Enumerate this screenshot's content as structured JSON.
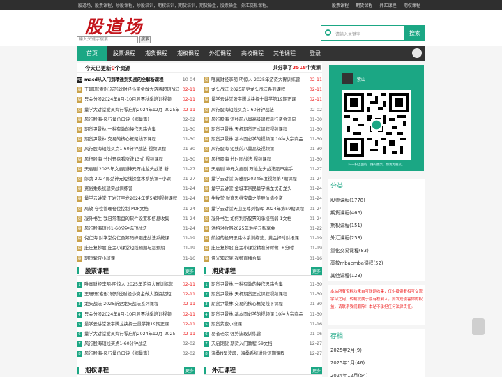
{
  "topbar": {
    "text": "股道场，股票课程，炒股课程，炒股培训，期权培训，期货培训，期货操盘，股票操盘，外汇交易课程。",
    "links": [
      "股票课程",
      "期货课程",
      "外汇课程",
      "期权课程"
    ]
  },
  "logo": "股道场",
  "mini_search": {
    "placeholder": "输入关键字搜索",
    "button": "搜索"
  },
  "search": {
    "placeholder": "请输入关键字",
    "button": "搜索"
  },
  "nav": [
    "首页",
    "股票课程",
    "期货课程",
    "期权课程",
    "外汇课程",
    "高校课程",
    "其他课程",
    "登录"
  ],
  "today": {
    "prefix": "今天已更新",
    "count": "0",
    "suffix": "个资源",
    "total_prefix": "共分享了",
    "total": "3518",
    "total_suffix": "个资源"
  },
  "latest_left": [
    {
      "t": "macd从入门到精通到实战的全解析课程",
      "d": "10-04",
      "hot": false,
      "first": true
    },
    {
      "t": "王珊珊(索彤)炭形说财经小资金做大游资超短战法",
      "d": "02-11",
      "hot": true
    },
    {
      "t": "只会分股2024年8月-10月股票秋季培训视频",
      "d": "02-11",
      "hot": true
    },
    {
      "t": "量学大讲堂爱灵海行零启航2024年12月-2025年1月",
      "d": "02-11",
      "hot": true
    },
    {
      "t": "风行股海-风行量价口诀（缩量篇）",
      "d": "02-02",
      "hot": false
    },
    {
      "t": "期货尹景林 一种有效的操作思路合集",
      "d": "01-30",
      "hot": false
    },
    {
      "t": "期货尹景林 交易的核心框架线下课程",
      "d": "01-30",
      "hot": false
    },
    {
      "t": "风行股海短线买点1-60分钟战法 视频课程",
      "d": "01-30",
      "hot": false
    },
    {
      "t": "风行股海 分时开盘看涨跌13式 视频课程",
      "d": "01-30",
      "hot": false
    },
    {
      "t": "天启剧 2025年文启剧神元万维龙头战法 新",
      "d": "01-27",
      "hot": false
    },
    {
      "t": "郎劲 2024郎劲神元短线操盘术系统课+小课",
      "d": "01-27",
      "hot": false
    },
    {
      "t": "资俗乘系统建实战训练营",
      "d": "01-24",
      "hot": false
    },
    {
      "t": "量学云讲堂 王岩江宇龙2024年第54期视频课程",
      "d": "01-24",
      "hot": false
    },
    {
      "t": "局放 仓位管理仓位控制 PDF文档",
      "d": "01-24",
      "hot": false
    },
    {
      "t": "凝外书生 我日常看盘的软件设置和信息收集",
      "d": "01-24",
      "hot": false
    },
    {
      "t": "风行股海短线1-60分钟选顶战法",
      "d": "01-24",
      "hot": false
    },
    {
      "t": "倪仁海 财学堂倪仁勇筹码峰跟庄战法系统课",
      "d": "01-19",
      "hot": false
    },
    {
      "t": "庄庄复抄股 庄主小课堂短线预期与超预期",
      "d": "01-19",
      "hot": false
    },
    {
      "t": "期货紫夜小班课",
      "d": "01-16",
      "hot": false
    }
  ],
  "latest_right": [
    {
      "t": "唯真财经李明-明惊人 2025年游资大胃训练营",
      "d": "02-11",
      "hot": true
    },
    {
      "t": "龙头战法 2025新更龙头战法系列课程",
      "d": "02-11",
      "hot": true
    },
    {
      "t": "量学云讲堂张宇腾龙抉择士量学第19期正课",
      "d": "02-11",
      "hot": true
    },
    {
      "t": "风行股海短线买点1-60分钟战法",
      "d": "02-02",
      "hot": false
    },
    {
      "t": "风行股海 短线前八量高级课程风行资金流向",
      "d": "01-30",
      "hot": false
    },
    {
      "t": "期货尹景林 天机期货正式课程视频课程",
      "d": "01-30",
      "hot": false
    },
    {
      "t": "期货尹景林 基本面必学的视频课 10种大宗商品",
      "d": "01-30",
      "hot": false
    },
    {
      "t": "风行股海 短线前八量高级视频课",
      "d": "01-30",
      "hot": false
    },
    {
      "t": "风行股海 分时图战法 视频课程",
      "d": "01-30",
      "hot": false
    },
    {
      "t": "天启剧 神元文启剧 万维龙头战法股市高手",
      "d": "01-27",
      "hot": false
    },
    {
      "t": "量学云讲堂 冯雅丽2024年度视频第7期课程",
      "d": "01-24",
      "hot": false
    },
    {
      "t": "量学云讲堂 金城李宗民量学擒龙伏击龙头",
      "d": "01-24",
      "hot": false
    },
    {
      "t": "牛牧堂 财商思维宝典之美股价值投资",
      "d": "01-24",
      "hot": false
    },
    {
      "t": "量学云讲堂天山至尊刘智晖 2024年第59期课程",
      "d": "01-24",
      "hot": false
    },
    {
      "t": "凝外书生 如何判断股票的承接强弱 1文档",
      "d": "01-24",
      "hot": false
    },
    {
      "t": "洪榕洪攻略2025年洪榕云私享会",
      "d": "01-22",
      "hot": false
    },
    {
      "t": "航姐的投研思路体系训练营，黄金择时财报课",
      "d": "01-19",
      "hot": false
    },
    {
      "t": "庄庄复抄股 庄主小课堂精准分时做T+分时",
      "d": "01-19",
      "hot": false
    },
    {
      "t": "佛光知识底 视频直播合集",
      "d": "01-16",
      "hot": false
    }
  ],
  "stock": {
    "title": "股票课程",
    "more": "更多",
    "items": [
      {
        "t": "唯真财经李明-明惊人 2025年游资大胃训练营",
        "d": "02-11",
        "hot": true
      },
      {
        "t": "王珊珊(索彤)炭形说财经小资金做大游资超短",
        "d": "02-11",
        "hot": true
      },
      {
        "t": "龙头战法 2025新更龙头战法系列课程",
        "d": "02-11",
        "hot": true
      },
      {
        "t": "只会分股2024年8月-10月股票秋季培训视频",
        "d": "02-11",
        "hot": true
      },
      {
        "t": "量学云讲堂张宇腾龙抉择士量学第19期正课",
        "d": "02-11",
        "hot": true
      },
      {
        "t": "量学大讲堂爱灵海行零启航2024年12月-2025",
        "d": "02-11",
        "hot": true
      },
      {
        "t": "风行股海短线买点1-60分钟战法",
        "d": "02-02",
        "hot": false
      },
      {
        "t": "风行股海-风行量价口诀（缩量篇）",
        "d": "02-02",
        "hot": false
      }
    ]
  },
  "futures": {
    "title": "期货课程",
    "more": "更多",
    "items": [
      {
        "t": "期货尹景林 一种有效的操作思路合集",
        "d": "01-30",
        "hot": false
      },
      {
        "t": "期货尹景林 天机期货正式课程视频课程",
        "d": "01-30",
        "hot": false
      },
      {
        "t": "期货尹景林 交易的核心框架线下课程",
        "d": "01-30",
        "hot": false
      },
      {
        "t": "期货尹景林 基本面必学的视频课 10种大宗商品",
        "d": "01-30",
        "hot": false
      },
      {
        "t": "期货紫夜小班课",
        "d": "01-16",
        "hot": false
      },
      {
        "t": "易者老余 强势波段训练营",
        "d": "01-06",
        "hot": false
      },
      {
        "t": "天启期货 期货入门教程 59文档",
        "d": "12-27",
        "hot": false
      },
      {
        "t": "海桑N型波段，海桑系统进阶短期课程",
        "d": "12-27",
        "hot": false
      }
    ]
  },
  "options": {
    "title": "期权课程",
    "more": "更多"
  },
  "forex": {
    "title": "外汇课程",
    "more": "更多"
  },
  "qr": {
    "name": "紫山",
    "caption": "扫一扫上面的二维码图案，加我为朋友。"
  },
  "categories": {
    "title": "分类",
    "items": [
      "股票课程(1778)",
      "期货课程(466)",
      "期权课程(151)",
      "外汇课程(253)",
      "量化交易课程(83)",
      "高校mbaemba课程(52)",
      "其他课程(123)"
    ]
  },
  "notice": "本站所有资料均来自互联网收集，仅供投资者相互交流学习之用，转载权属于原有权利人。如发现侵害你的权益，请联系我们删除！本站不承担任何法律责任。",
  "archive": {
    "title": "存档",
    "items": [
      "2025年2月(9)",
      "2025年1月(46)",
      "2024年12月(54)"
    ]
  }
}
